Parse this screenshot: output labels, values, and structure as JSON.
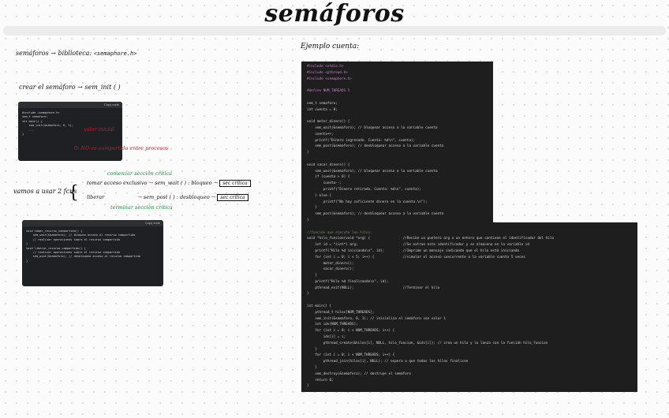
{
  "title": "semáforos",
  "left": {
    "lib_label": "semáforos → biblioteca:",
    "lib_value": "<semaphore.h>",
    "create_label": "crear el semáforo → sem_init ( )",
    "shot1": {
      "header": "Copy code",
      "lines": [
        "#include <semaphore.h>",
        "",
        "sem_t semaforo;",
        "",
        "int main() {",
        "    sem_init(&semaforo, 0, 1);",
        "    ...",
        "}"
      ],
      "ann_value": "valor inicial",
      "ann_shared": "0: NO es compartido entre procesos"
    },
    "ops_label": "vamos a usar 2 fcns",
    "lock_label": "tomar acceso exclusivo",
    "lock_fn": "sem_wait ( ) : bloqueo",
    "lock_box": "sec crítica",
    "unlock_label": "liberar",
    "unlock_fn": "sem_post ( ) : desbloqueo",
    "unlock_box": "sec crítica",
    "green_top": "comenzar sección crítica",
    "green_bottom": "terminar sección crítica",
    "shot2": {
      "header": "Copy code",
      "lines": [
        "void tomar_recurso_compartido() {",
        "    sem_wait(&semaforo); // bloquea acceso al recurso compartido",
        "    // realizar operaciones sobre el recurso compartido",
        "}",
        "",
        "void liberar_recurso_compartido() {",
        "    // realizar operaciones sobre el recurso compartido",
        "    sem_post(&semaforo); // desbloquea acceso al recurso compartido",
        "}"
      ]
    }
  },
  "right": {
    "example_label": "Ejemplo cuenta:",
    "code": [
      "#include <stdio.h>",
      "#include <pthread.h>",
      "#include <semaphore.h>",
      "",
      "#define NUM_THREADS 5",
      "",
      "sem_t semaforo;",
      "int cuenta = 0;",
      "",
      "void meter_dinero() {",
      "    sem_wait(&semaforo); // bloquear acceso a la variable cuenta",
      "    cuenta++;",
      "    printf(\"Dinero ingresado. Cuenta: %d\\n\", cuenta);",
      "    sem_post(&semaforo); // desbloquear acceso a la variable cuenta",
      "}",
      "",
      "void sacar_dinero() {",
      "    sem_wait(&semaforo); // bloquear acceso a la variable cuenta",
      "    if (cuenta > 0) {",
      "        cuenta--;",
      "        printf(\"Dinero retirado. Cuenta: %d\\n\", cuenta);",
      "    } else {",
      "        printf(\"No hay suficiente dinero en la cuenta.\\n\");",
      "    }",
      "    sem_post(&semaforo); // desbloquear acceso a la variable cuenta",
      "}",
      "",
      "//función que ejecuta los hilos:",
      "void *hilo_funcion(void *arg) {                //Recibe un puntero arg a un entero que contiene el identificador del hilo",
      "    int id = *(int*) arg;                      //Se extrae este identificador y se almacena en la variable id",
      "    printf(\"Hilo %d iniciando\\n\", id);         //Imprime un mensaje indicando que el hilo está iniciando",
      "    for (int i = 0; i < 5; i++) {              //simular el acceso concurrente a la variable cuenta 5 veces",
      "        meter_dinero();",
      "        sacar_dinero();",
      "    }",
      "    printf(\"Hilo %d finalizando\\n\", id);",
      "    pthread_exit(NULL);                        //Terminar el hilo",
      "}",
      "",
      "int main() {",
      "    pthread_t hilos[NUM_THREADS];",
      "    sem_init(&semaforo, 0, 1); // inicializa el semáforo con valor 1",
      "    int ids[NUM_THREADS];",
      "    for (int i = 0; i < NUM_THREADS; i++) {",
      "        ids[i] = i;",
      "        pthread_create(&hilos[i], NULL, hilo_funcion, &ids[i]); // crea un hilo y lo lanza con la función hilo_funcion",
      "    }",
      "    for (int i = 0; i < NUM_THREADS; i++) {",
      "        pthread_join(hilos[i], NULL); // espera a que todos los hilos finalicen",
      "    }",
      "    sem_destroy(&semaforo); // destruye el semáforo",
      "    return 0;",
      "}"
    ]
  }
}
